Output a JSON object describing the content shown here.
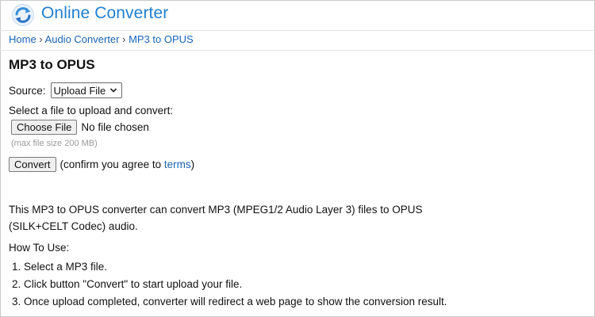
{
  "header": {
    "brand": "Online Converter",
    "logo_icon": "refresh-arrows-icon"
  },
  "breadcrumb": {
    "items": [
      "Home",
      "Audio Converter",
      "MP3 to OPUS"
    ],
    "separator": "›"
  },
  "page": {
    "title": "MP3 to OPUS"
  },
  "form": {
    "source_label": "Source:",
    "source_value": "Upload File",
    "upload_label": "Select a file to upload and convert:",
    "choose_file_label": "Choose File",
    "file_status": "No file chosen",
    "max_size": "(max file size 200 MB)",
    "convert_label": "Convert",
    "confirm_prefix": "(confirm you agree to ",
    "terms_link": "terms",
    "confirm_suffix": ")"
  },
  "description": {
    "line1": "This MP3 to OPUS converter can convert MP3 (MPEG1/2 Audio Layer 3) files to OPUS",
    "line2": "(SILK+CELT Codec) audio."
  },
  "howto": {
    "title": "How To Use:",
    "steps": [
      {
        "num": "1.",
        "text": "Select a MP3 file."
      },
      {
        "num": "2.",
        "text": "Click button \"Convert\" to start upload your file."
      },
      {
        "num": "3.",
        "text": "Once upload completed, converter will redirect a web page to show the conversion result."
      }
    ]
  },
  "colors": {
    "brand": "#1f7fd1",
    "link": "#1a64b8",
    "muted": "#9a9a9a"
  }
}
